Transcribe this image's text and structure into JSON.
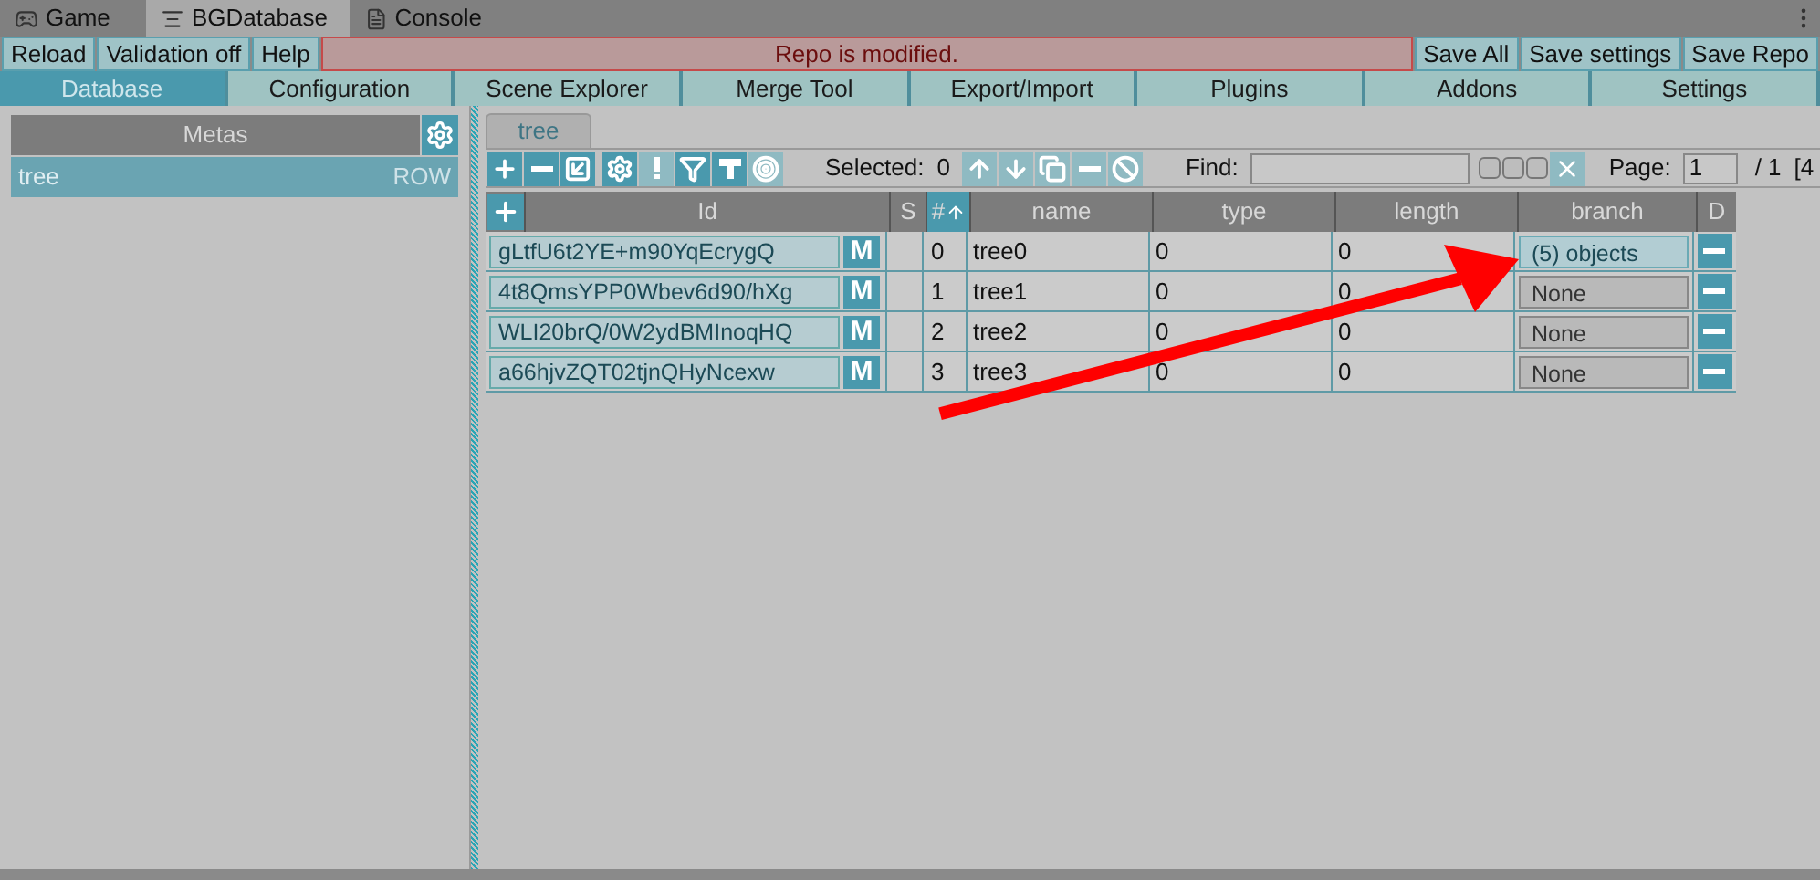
{
  "window_tabs": [
    {
      "label": "Game",
      "kind": "game",
      "selected": false
    },
    {
      "label": "BGDatabase",
      "kind": "db",
      "selected": true
    },
    {
      "label": "Console",
      "kind": "console",
      "selected": false
    }
  ],
  "actions_left": [
    "Reload",
    "Validation off",
    "Help"
  ],
  "banner": "Repo is modified.",
  "actions_right": [
    "Save All",
    "Save settings",
    "Save Repo"
  ],
  "nav_tabs": [
    {
      "label": "Database",
      "selected": true
    },
    {
      "label": "Configuration",
      "selected": false
    },
    {
      "label": "Scene Explorer",
      "selected": false
    },
    {
      "label": "Merge Tool",
      "selected": false
    },
    {
      "label": "Export/Import",
      "selected": false
    },
    {
      "label": "Plugins",
      "selected": false
    },
    {
      "label": "Addons",
      "selected": false
    },
    {
      "label": "Settings",
      "selected": false
    }
  ],
  "metas": {
    "title": "Metas",
    "items": [
      {
        "name": "tree",
        "type": "ROW",
        "selected": true
      }
    ]
  },
  "table_tab": "tree",
  "toolbar": [
    {
      "kind": "add",
      "disabled": false
    },
    {
      "kind": "remove",
      "disabled": false
    },
    {
      "kind": "edit",
      "disabled": false
    },
    {
      "kind": "settings",
      "disabled": false
    },
    {
      "kind": "alert",
      "disabled": true
    },
    {
      "kind": "filter",
      "disabled": false
    },
    {
      "kind": "tshape",
      "disabled": false
    },
    {
      "kind": "target",
      "disabled": true
    }
  ],
  "selected_label": "Selected:",
  "selected_count": "0",
  "selection_tools": [
    {
      "kind": "up"
    },
    {
      "kind": "down"
    },
    {
      "kind": "copy"
    },
    {
      "kind": "minus"
    },
    {
      "kind": "clear"
    }
  ],
  "find": {
    "label": "Find:",
    "toggles": [
      {
        "checked": false
      },
      {
        "checked": false
      },
      {
        "checked": false
      }
    ]
  },
  "page": {
    "label": "Page:",
    "value": "1",
    "total": "/ 1",
    "extra": "[4"
  },
  "table": {
    "columns": [
      "Id",
      "S",
      "#",
      "name",
      "type",
      "length",
      "branch",
      "D"
    ],
    "rows": [
      {
        "id": "gLtfU6t2YE+m90YqEcrygQ",
        "m": "M",
        "index": "0",
        "name": "tree0",
        "type": "0",
        "length": "0",
        "branch": {
          "text": "(5) objects",
          "set": true
        }
      },
      {
        "id": "4t8QmsYPP0Wbev6d90/hXg",
        "m": "M",
        "index": "1",
        "name": "tree1",
        "type": "0",
        "length": "0",
        "branch": {
          "text": "None",
          "set": false
        }
      },
      {
        "id": "WLI20brQ/0W2ydBMInoqHQ",
        "m": "M",
        "index": "2",
        "name": "tree2",
        "type": "0",
        "length": "0",
        "branch": {
          "text": "None",
          "set": false
        }
      },
      {
        "id": "a66hjvZQT02tjnQHyNcexw",
        "m": "M",
        "index": "3",
        "name": "tree3",
        "type": "0",
        "length": "0",
        "branch": {
          "text": "None",
          "set": false
        }
      }
    ]
  }
}
